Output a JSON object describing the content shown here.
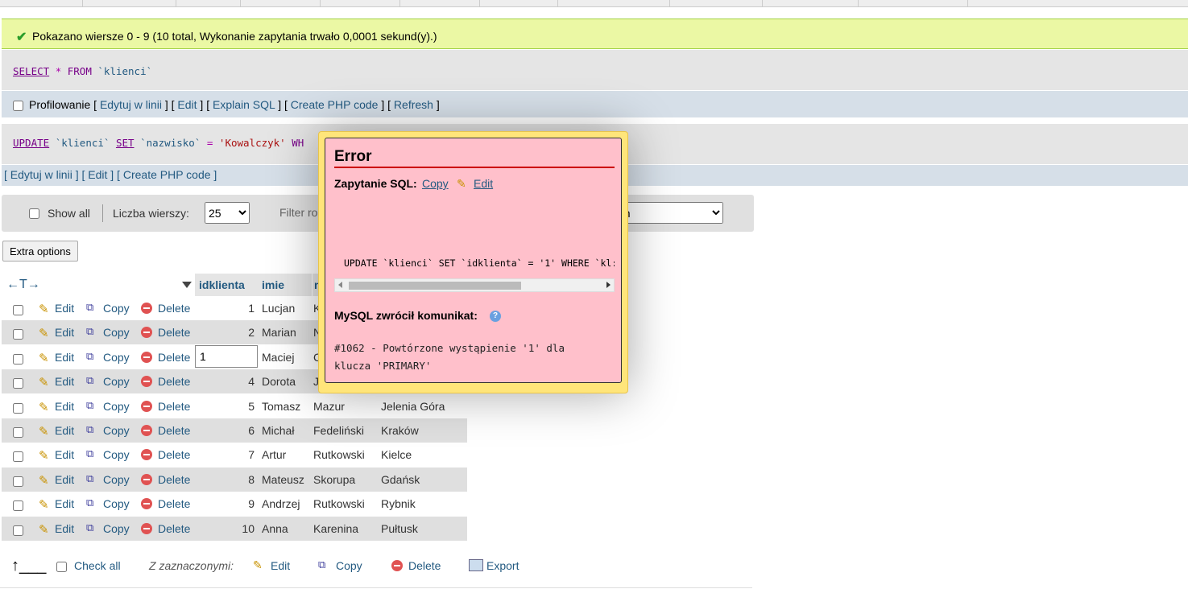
{
  "success": {
    "message": "Pokazano wiersze 0 - 9 (10 total, Wykonanie zapytania trwało 0,0001 sekund(y).)"
  },
  "query1": {
    "kw_select": "SELECT",
    "star": "*",
    "kw_from": "FROM",
    "table": "`klienci`"
  },
  "profiling": {
    "label": "Profilowanie",
    "links": [
      "Edytuj w linii",
      "Edit",
      "Explain SQL",
      "Create PHP code",
      "Refresh"
    ]
  },
  "query2": {
    "kw_update": "UPDATE",
    "table": "`klienci`",
    "kw_set": "SET",
    "col": "`nazwisko`",
    "eq": "=",
    "val": "'Kowalczyk'",
    "rest": "WH"
  },
  "query2_links": [
    "Edytuj w linii",
    "Edit",
    "Create PHP code"
  ],
  "navbar": {
    "show_all": "Show all",
    "rows_label": "Liczba wierszy:",
    "rows_value": "25",
    "filter_label": "Filter ro",
    "sort_value": "en"
  },
  "extra_options": "Extra options",
  "table": {
    "headers": {
      "arrows": "←T→",
      "id": "idklienta",
      "imie": "imie",
      "nazwisko": "n"
    },
    "actions": {
      "edit": "Edit",
      "copy": "Copy",
      "delete": "Delete"
    },
    "editing_value": "1",
    "rows": [
      {
        "id": "1",
        "imie": "Lucjan",
        "nazwisko": "K",
        "miasto": ""
      },
      {
        "id": "2",
        "imie": "Marian",
        "nazwisko": "N",
        "miasto": ""
      },
      {
        "id": "",
        "imie": "Maciej",
        "nazwisko": "C",
        "miasto": ""
      },
      {
        "id": "4",
        "imie": "Dorota",
        "nazwisko": "J",
        "miasto": ""
      },
      {
        "id": "5",
        "imie": "Tomasz",
        "nazwisko": "Mazur",
        "miasto": "Jelenia Góra"
      },
      {
        "id": "6",
        "imie": "Michał",
        "nazwisko": "Fedeliński",
        "miasto": "Kraków"
      },
      {
        "id": "7",
        "imie": "Artur",
        "nazwisko": "Rutkowski",
        "miasto": "Kielce"
      },
      {
        "id": "8",
        "imie": "Mateusz",
        "nazwisko": "Skorupa",
        "miasto": "Gdańsk"
      },
      {
        "id": "9",
        "imie": "Andrzej",
        "nazwisko": "Rutkowski",
        "miasto": "Rybnik"
      },
      {
        "id": "10",
        "imie": "Anna",
        "nazwisko": "Karenina",
        "miasto": "Pułtusk"
      }
    ]
  },
  "bottom": {
    "check_all": "Check all",
    "with_selected": "Z zaznaczonymi:",
    "edit": "Edit",
    "copy": "Copy",
    "delete": "Delete",
    "export": "Export"
  },
  "error": {
    "title": "Error",
    "sql_label": "Zapytanie SQL:",
    "copy": "Copy",
    "edit": "Edit",
    "query": "UPDATE `klienci` SET `idklienta` = '1' WHERE `kl:",
    "mysql_label": "MySQL zwrócił komunikat:",
    "message": "#1062 - Powtórzone wystąpienie '1' dla\nklucza 'PRIMARY'"
  }
}
